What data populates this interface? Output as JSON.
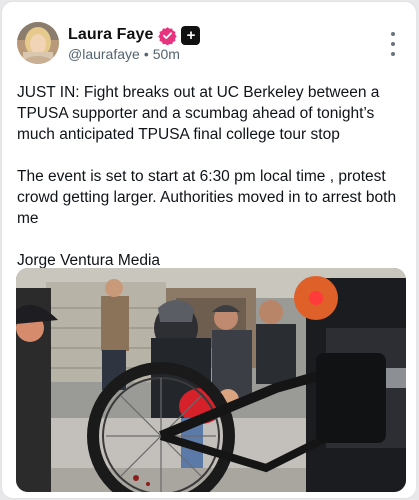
{
  "author": {
    "display_name": "Laura Faye",
    "handle": "@laurafaye",
    "separator": "•",
    "timestamp": "50m",
    "verified_icon": "verified-badge-icon",
    "plus_icon": "plus-badge-icon",
    "accent_color": "#e8337f"
  },
  "post": {
    "paragraphs": [
      "JUST IN: Fight breaks out at UC Berkeley between a TPUSA supporter and a scumbag ahead of tonight’s much anticipated TPUSA final college tour stop",
      "The event is set to start at 6:30 pm local time , protest crowd getting larger. Authorities moved in to arrest both me",
      "Jorge Ventura Media"
    ]
  },
  "media": {
    "icon": "photo-media",
    "description_visible": false
  },
  "menu": {
    "icon": "more-options-icon"
  }
}
